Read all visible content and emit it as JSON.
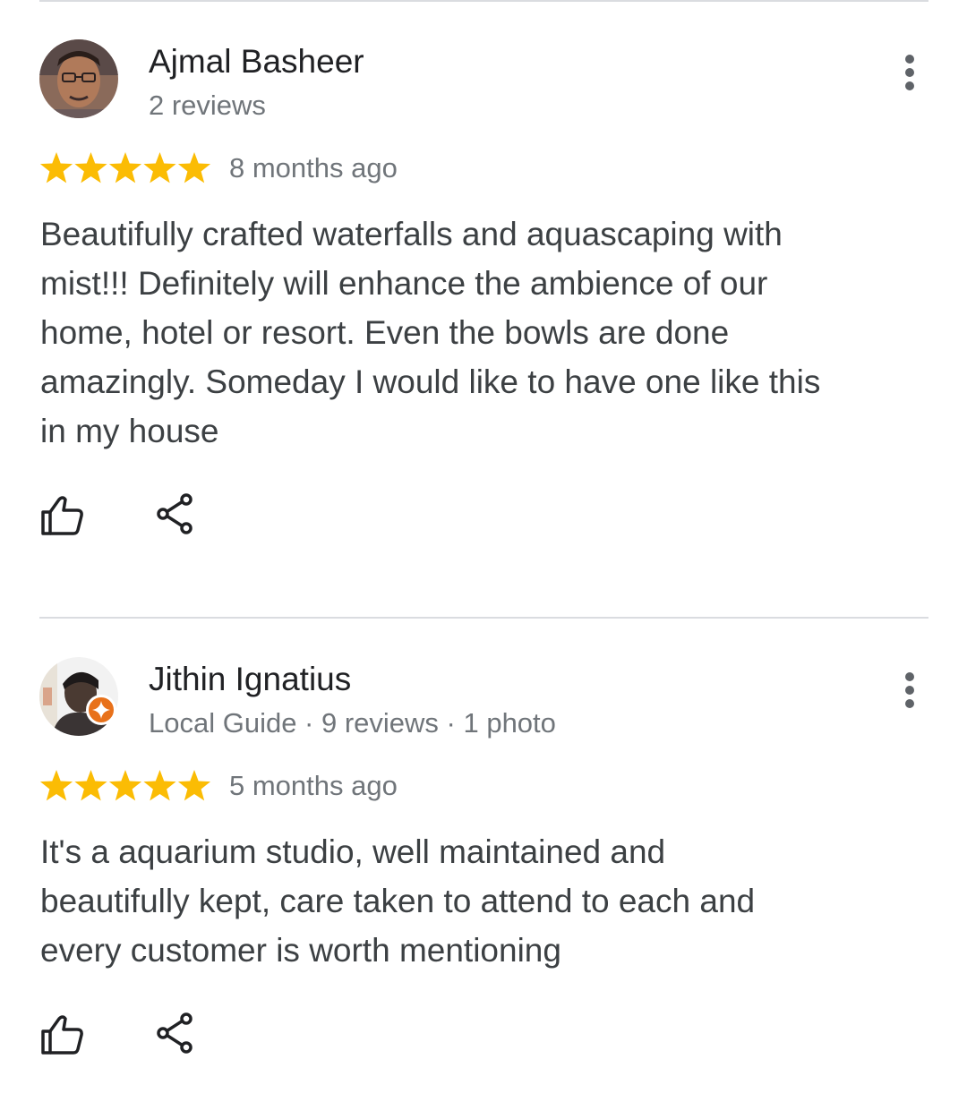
{
  "reviews": [
    {
      "name": "Ajmal Basheer",
      "meta": "2 reviews",
      "rating": 5,
      "time": "8 months ago",
      "text": "Beautifully crafted waterfalls and aquascaping with\nmist!!! Definitely will enhance the ambience of our\nhome, hotel or resort. Even the bowls are done\namazingly. Someday I would like to have one like this\nin my house",
      "local_guide": false
    },
    {
      "name": "Jithin Ignatius",
      "meta": "Local Guide · 9 reviews · 1 photo",
      "rating": 5,
      "time": "5 months ago",
      "text": "It's a aquarium  studio,  well maintained  and\nbeautifully kept, care taken to attend  to each and\nevery customer is worth mentioning",
      "local_guide": true
    }
  ],
  "icons": {
    "more": "more-vert-icon",
    "like": "thumb-up-icon",
    "share": "share-icon",
    "star": "star-icon",
    "badge": "local-guide-badge-icon"
  },
  "colors": {
    "star": "#fbbc04",
    "badge": "#e8711a",
    "divider": "#dadce0"
  }
}
